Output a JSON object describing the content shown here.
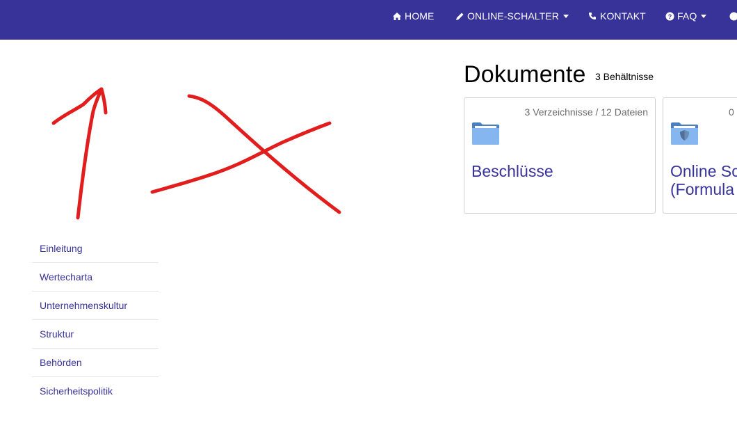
{
  "navbar": {
    "items": [
      {
        "label": "HOME",
        "icon": "home-icon"
      },
      {
        "label": "ONLINE-SCHALTER",
        "icon": "pencil-icon",
        "dropdown": true
      },
      {
        "label": "KONTAKT",
        "icon": "phone-icon"
      },
      {
        "label": "FAQ",
        "icon": "question-circle-icon",
        "dropdown": true
      }
    ],
    "background": "#383399"
  },
  "annotation": {
    "color": "#e11d1d"
  },
  "sidebar": {
    "items": [
      {
        "label": "Einleitung"
      },
      {
        "label": "Wertecharta"
      },
      {
        "label": "Unternehmenskultur"
      },
      {
        "label": "Struktur"
      },
      {
        "label": "Behörden"
      },
      {
        "label": "Sicherheitspolitik"
      }
    ]
  },
  "main": {
    "title": "Dokumente",
    "count": "3 Behältnisse",
    "cards": [
      {
        "meta": "3 Verzeichnisse / 12 Dateien",
        "title": "Beschlüsse",
        "icon": "folder-icon"
      },
      {
        "meta": "0",
        "title_line1": "Online Sc",
        "title_line2": "(Formula",
        "icon": "shield-folder-icon"
      }
    ]
  },
  "colors": {
    "accent": "#383399",
    "link": "#383399"
  }
}
